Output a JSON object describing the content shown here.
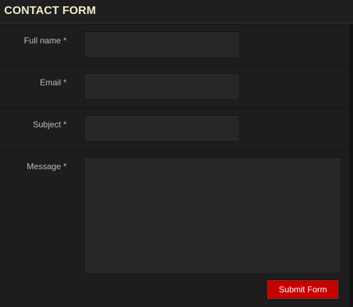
{
  "form": {
    "title": "CONTACT FORM",
    "fields": {
      "full_name": {
        "label": "Full name *",
        "value": "",
        "placeholder": ""
      },
      "email": {
        "label": "Email *",
        "value": "",
        "placeholder": ""
      },
      "subject": {
        "label": "Subject *",
        "value": "",
        "placeholder": ""
      },
      "message": {
        "label": "Message *",
        "value": "",
        "placeholder": ""
      }
    },
    "submit_label": "Submit Form"
  },
  "colors": {
    "background": "#1b1b1b",
    "title": "#f2ecce",
    "label": "#bdbdbd",
    "input_background": "#272727",
    "submit_background": "#c70000"
  }
}
